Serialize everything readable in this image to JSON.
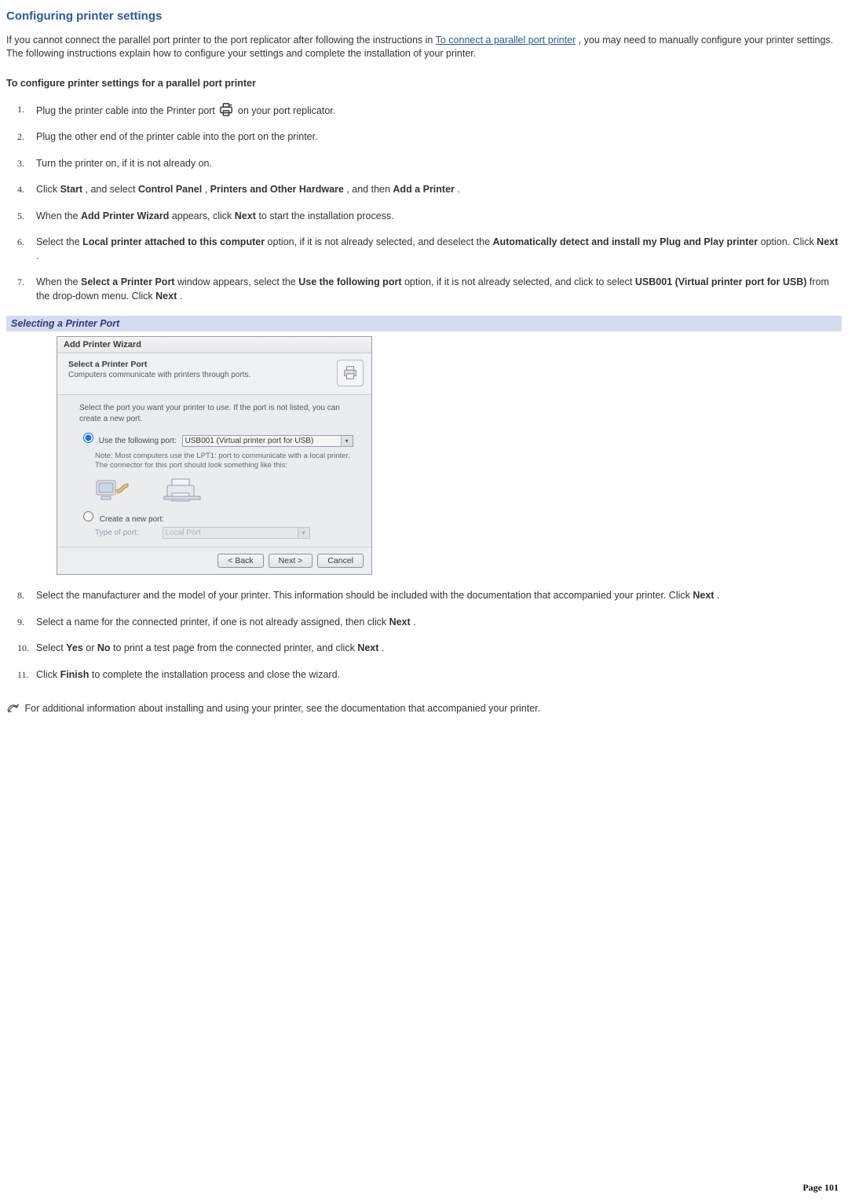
{
  "page_title": "Configuring printer settings",
  "intro_pre": "If you cannot connect the parallel port printer to the port replicator after following the instructions in ",
  "intro_link": "To connect a parallel port printer",
  "intro_post": ", you may need to manually configure your printer settings. The following instructions explain how to configure your settings and complete the installation of your printer.",
  "section_heading": "To configure printer settings for a parallel port printer",
  "steps_a": {
    "s1_pre": "Plug the printer cable into the Printer port ",
    "s1_post": " on your port replicator.",
    "s2": "Plug the other end of the printer cable into the port on the printer.",
    "s3": "Turn the printer on, if it is not already on.",
    "s4_pre": "Click ",
    "s4_b1": "Start",
    "s4_mid1": ", and select ",
    "s4_b2": "Control Panel",
    "s4_mid2": ", ",
    "s4_b3": "Printers and Other Hardware",
    "s4_mid3": ", and then ",
    "s4_b4": "Add a Printer",
    "s4_post": ".",
    "s5_pre": "When the ",
    "s5_b1": "Add Printer Wizard",
    "s5_mid": " appears, click ",
    "s5_b2": "Next",
    "s5_post": " to start the installation process.",
    "s6_pre": "Select the ",
    "s6_b1": "Local printer attached to this computer",
    "s6_mid1": " option, if it is not already selected, and deselect the ",
    "s6_b2": "Automatically detect and install my Plug and Play printer",
    "s6_mid2": " option. Click ",
    "s6_b3": "Next",
    "s6_post": ".",
    "s7_pre": "When the ",
    "s7_b1": "Select a Printer Port",
    "s7_mid1": " window appears, select the ",
    "s7_b2": "Use the following port",
    "s7_mid2": " option, if it is not already selected, and click to select ",
    "s7_b3": "USB001 (Virtual printer port for USB)",
    "s7_mid3": " from the drop-down menu. Click ",
    "s7_b4": "Next",
    "s7_post": "."
  },
  "caption": "Selecting a Printer Port",
  "wizard": {
    "titlebar": "Add Printer Wizard",
    "header_title": "Select a Printer Port",
    "header_sub": "Computers communicate with printers through ports.",
    "body_intro": "Select the port you want your printer to use. If the port is not listed, you can create a new port.",
    "use_port_label": "Use the following port:",
    "port_value": "USB001 (Virtual printer port for USB)",
    "note": "Note: Most computers use the LPT1: port to communicate with a local printer. The connector for this port should look something like this:",
    "create_port_label": "Create a new port:",
    "type_label": "Type of port:",
    "type_value": "Local Port",
    "btn_back": "< Back",
    "btn_next": "Next >",
    "btn_cancel": "Cancel"
  },
  "steps_b": {
    "s8_pre": "Select the manufacturer and the model of your printer. This information should be included with the documentation that accompanied your printer. Click ",
    "s8_b": "Next",
    "s8_post": ".",
    "s9_pre": "Select a name for the connected printer, if one is not already assigned, then click ",
    "s9_b": "Next",
    "s9_post": ".",
    "s10_pre": "Select ",
    "s10_b1": "Yes",
    "s10_mid1": " or ",
    "s10_b2": "No",
    "s10_mid2": " to print a test page from the connected printer, and click ",
    "s10_b3": "Next",
    "s10_post": ".",
    "s11_pre": "Click ",
    "s11_b": "Finish",
    "s11_post": " to complete the installation process and close the wizard."
  },
  "footer_note": " For additional information about installing and using your printer, see the documentation that accompanied your printer.",
  "page_number": "Page 101"
}
